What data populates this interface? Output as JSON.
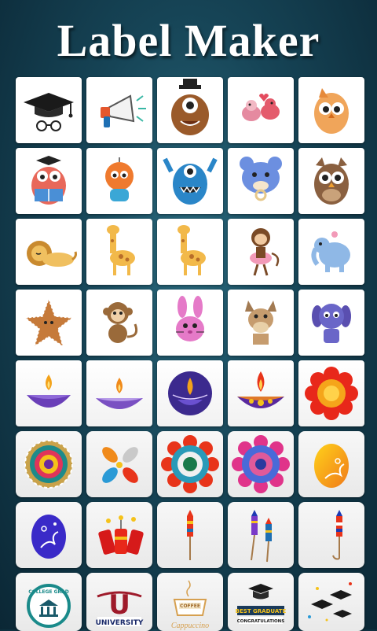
{
  "app": {
    "title": "Label Maker"
  },
  "stickers": [
    {
      "name": "graduation-cap-glasses-icon"
    },
    {
      "name": "megaphone-icon"
    },
    {
      "name": "brown-monster-icon"
    },
    {
      "name": "love-birds-icon"
    },
    {
      "name": "orange-owl-icon"
    },
    {
      "name": "reading-owl-icon"
    },
    {
      "name": "orange-monster-icon"
    },
    {
      "name": "blue-monster-icon"
    },
    {
      "name": "blue-bear-pacifier-icon"
    },
    {
      "name": "brown-owl-icon"
    },
    {
      "name": "sleeping-lion-icon"
    },
    {
      "name": "giraffe-icon"
    },
    {
      "name": "giraffe-2-icon"
    },
    {
      "name": "monkey-ballerina-icon"
    },
    {
      "name": "elephant-icon"
    },
    {
      "name": "gingerbread-starfish-icon"
    },
    {
      "name": "monkey-icon"
    },
    {
      "name": "pink-bunny-icon"
    },
    {
      "name": "donkey-icon"
    },
    {
      "name": "purple-dog-icon"
    },
    {
      "name": "diya-lamp-icon"
    },
    {
      "name": "diya-lamp-2-icon"
    },
    {
      "name": "diya-circle-icon"
    },
    {
      "name": "decorated-diya-icon"
    },
    {
      "name": "sun-flower-icon"
    },
    {
      "name": "rangoli-icon"
    },
    {
      "name": "petal-diyas-icon"
    },
    {
      "name": "rangoli-flower-icon"
    },
    {
      "name": "rangoli-flower-2-icon"
    },
    {
      "name": "yellow-easter-egg-icon"
    },
    {
      "name": "blue-easter-egg-icon"
    },
    {
      "name": "firecrackers-icon"
    },
    {
      "name": "firework-rocket-icon"
    },
    {
      "name": "firework-rockets-icon"
    },
    {
      "name": "firework-rocket-2-icon"
    },
    {
      "name": "college-badge-icon"
    },
    {
      "name": "university-badge-icon"
    },
    {
      "name": "coffee-cup-icon"
    },
    {
      "name": "graduate-badge-icon"
    },
    {
      "name": "graduation-caps-icon"
    }
  ],
  "labels": {
    "college": "COLLEGE GRAD",
    "u": "U",
    "university": "UNIVERSITY",
    "coffee": "COFFEE",
    "cappuccino": "Cappuccino",
    "best_graduate": "BEST GRADUATE",
    "congratulations": "CONGRATULATIONS"
  },
  "colors": {
    "background": "#164456",
    "tile": "#ffffff"
  }
}
